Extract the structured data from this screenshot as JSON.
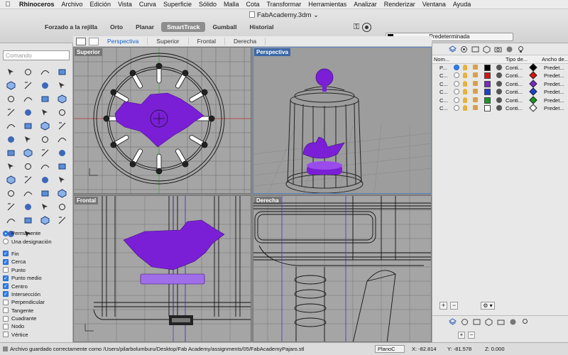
{
  "menubar": {
    "items": [
      "Rhinoceros",
      "Archivo",
      "Edición",
      "Vista",
      "Curva",
      "Superficie",
      "Sólido",
      "Malla",
      "Cota",
      "Transformar",
      "Herramientas",
      "Analizar",
      "Renderizar",
      "Ventana",
      "Ayuda"
    ],
    "apple_icon": "apple-icon"
  },
  "window": {
    "title": "FabAcademy.3dm"
  },
  "osnap_tabs": [
    {
      "label": "Forzado a la rejilla",
      "active": false
    },
    {
      "label": "Orto",
      "active": false
    },
    {
      "label": "Planar",
      "active": false
    },
    {
      "label": "SmartTrack",
      "active": true
    },
    {
      "label": "Gumball",
      "active": false
    },
    {
      "label": "Historial",
      "active": false
    }
  ],
  "layer_select": {
    "value": "Predeterminada",
    "swatch": "#000000"
  },
  "viewport_tabs": [
    "Perspectiva",
    "Superior",
    "Frontal",
    "Derecha"
  ],
  "command": {
    "placeholder": "Comando"
  },
  "tools": [
    "select-arrow-icon",
    "point-icon",
    "curve-icon",
    "line-icon",
    "polyline-icon",
    "interp-curve-icon",
    "circle-icon",
    "arc-icon",
    "rectangle-icon",
    "polygon-icon",
    "fillet-icon",
    "offset-icon",
    "extrude-icon",
    "revolve-icon",
    "loft-icon",
    "sweep-icon",
    "surface-icon",
    "box-icon",
    "sphere-icon",
    "cylinder-icon",
    "boolean-union-icon",
    "boolean-diff-icon",
    "trim-icon",
    "split-icon",
    "join-icon",
    "explode-icon",
    "move-icon",
    "copy-icon",
    "rotate-icon",
    "scale-icon",
    "mirror-icon",
    "array-icon",
    "group-icon",
    "ungroup-icon",
    "check-icon",
    "dimension-icon",
    "text-icon",
    "hatch-icon",
    "analysis-icon",
    "light-icon",
    "layer-icon",
    "display-icon",
    "render-icon",
    "material-icon",
    "lock-icon",
    "hide-icon",
    "paint-icon",
    "camera-icon",
    "sphere-render-icon",
    "tag-icon"
  ],
  "osnap": {
    "radio": [
      {
        "label": "Permanente",
        "on": true
      },
      {
        "label": "Una designación",
        "on": false
      }
    ],
    "checks": [
      {
        "label": "Fin",
        "on": true
      },
      {
        "label": "Cerca",
        "on": true
      },
      {
        "label": "Punto",
        "on": false
      },
      {
        "label": "Punto medio",
        "on": true
      },
      {
        "label": "Centro",
        "on": true
      },
      {
        "label": "Intersección",
        "on": true
      },
      {
        "label": "Perpendicular",
        "on": false
      },
      {
        "label": "Tangente",
        "on": false
      },
      {
        "label": "Cuadrante",
        "on": false
      },
      {
        "label": "Nodo",
        "on": false
      },
      {
        "label": "Vértice",
        "on": false
      }
    ]
  },
  "viewports": {
    "superior": "Superior",
    "perspectiva": "Perspectiva",
    "frontal": "Frontal",
    "derecha": "Derecha"
  },
  "layers_panel": {
    "columns": {
      "name": "Nom...",
      "type": "Tipo de...",
      "width": "Ancho de..."
    },
    "rows": [
      {
        "name": "P...",
        "current": true,
        "color": "#000000",
        "type": "Conti...",
        "print_color": "#000000",
        "width": "Predet..."
      },
      {
        "name": "C...",
        "current": false,
        "color": "#dd1111",
        "type": "Conti...",
        "print_color": "#dd1111",
        "width": "Predet..."
      },
      {
        "name": "C...",
        "current": false,
        "color": "#7a28c8",
        "type": "Conti...",
        "print_color": "#7a28c8",
        "width": "Predet..."
      },
      {
        "name": "C...",
        "current": false,
        "color": "#1a3fd8",
        "type": "Conti...",
        "print_color": "#1a3fd8",
        "width": "Predet..."
      },
      {
        "name": "C...",
        "current": false,
        "color": "#149b23",
        "type": "Conti...",
        "print_color": "#149b23",
        "width": "Predet..."
      },
      {
        "name": "C...",
        "current": false,
        "color": "#ffffff",
        "type": "Conti...",
        "print_color": "#ffffff",
        "width": "Predet..."
      }
    ],
    "add_label": "+",
    "remove_label": "−",
    "gear_label": "⚙ ▾"
  },
  "status": {
    "message": "Archivo guardado correctamente como /Users/pilarbolumburu/Desktop/Fab Academy/assignments/05/FabAcademyPajaro.stl",
    "plane": "PlanoC",
    "x": "X: -82.814",
    "y": "Y: -81.578",
    "z": "Z: 0.000"
  },
  "colors": {
    "purple": "#7a1fd6",
    "accent": "#2e7df0"
  }
}
